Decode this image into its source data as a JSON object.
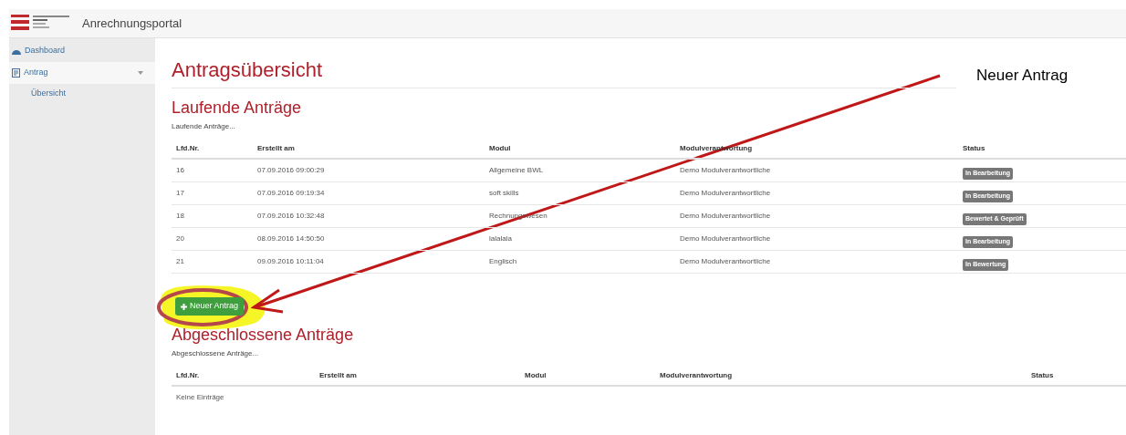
{
  "header": {
    "title": "Anrechnungsportal"
  },
  "sidebar": {
    "items": [
      {
        "label": "Dashboard"
      },
      {
        "label": "Antrag",
        "expanded": true,
        "children": [
          {
            "label": "Übersicht"
          }
        ]
      }
    ]
  },
  "page": {
    "title": "Antragsübersicht"
  },
  "running": {
    "title": "Laufende Anträge",
    "subtitle": "Laufende Anträge...",
    "columns": [
      "Lfd.Nr.",
      "Erstellt am",
      "Modul",
      "Modulverantwortung",
      "Status"
    ],
    "rows": [
      [
        "16",
        "07.09.2016 09:00:29",
        "Allgemeine BWL",
        "Demo Modulverantwortliche",
        "In Bearbeitung"
      ],
      [
        "17",
        "07.09.2016 09:19:34",
        "soft skills",
        "Demo Modulverantwortliche",
        "In Bearbeitung"
      ],
      [
        "18",
        "07.09.2016 10:32:48",
        "Rechnungswesen",
        "Demo Modulverantwortliche",
        "Bewertet & Geprüft"
      ],
      [
        "20",
        "08.09.2016 14:50:50",
        "lalalala",
        "Demo Modulverantwortliche",
        "In Bearbeitung"
      ],
      [
        "21",
        "09.09.2016 10:11:04",
        "Englisch",
        "Demo Modulverantwortliche",
        "In Bewertung"
      ]
    ]
  },
  "new_button": {
    "label": "Neuer Antrag"
  },
  "closed": {
    "title": "Abgeschlossene Anträge",
    "subtitle": "Abgeschlossene Anträge...",
    "columns": [
      "Lfd.Nr.",
      "Erstellt am",
      "Modul",
      "Modulverantwortung",
      "Status"
    ],
    "empty": "Keine Einträge"
  },
  "annotation": {
    "callout": "Neuer Antrag"
  }
}
